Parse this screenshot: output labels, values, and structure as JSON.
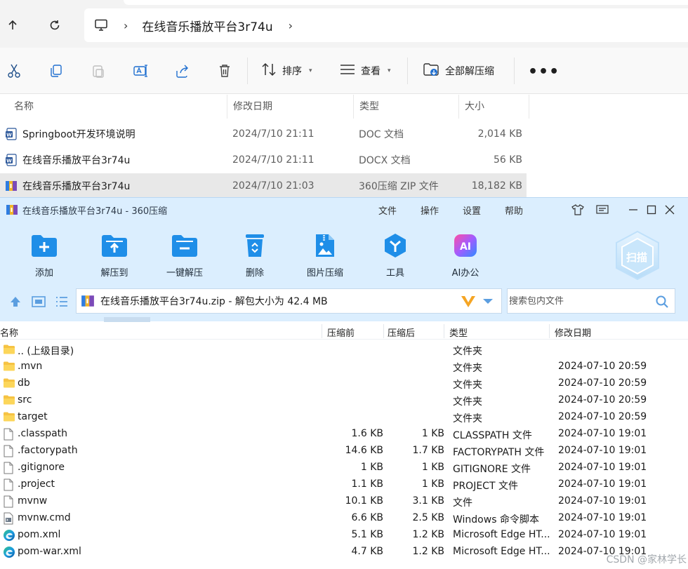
{
  "explorer": {
    "breadcrumb": "在线音乐播放平台3r74u",
    "toolbar": {
      "sort_label": "排序",
      "view_label": "查看",
      "extract_all_label": "全部解压缩"
    },
    "columns": [
      "名称",
      "修改日期",
      "类型",
      "大小"
    ],
    "files": [
      {
        "name": "Springboot开发环境说明",
        "date": "2024/7/10 21:11",
        "type": "DOC 文档",
        "size": "2,014 KB",
        "icon": "word-doc-icon"
      },
      {
        "name": "在线音乐播放平台3r74u",
        "date": "2024/7/10 21:11",
        "type": "DOCX 文档",
        "size": "56 KB",
        "icon": "word-doc-icon"
      },
      {
        "name": "在线音乐播放平台3r74u",
        "date": "2024/7/10 21:03",
        "type": "360压缩 ZIP 文件",
        "size": "18,182 KB",
        "icon": "zip-archive-icon"
      }
    ]
  },
  "zip": {
    "title": "在线音乐播放平台3r74u - 360压缩",
    "menu": [
      "文件",
      "操作",
      "设置",
      "帮助"
    ],
    "tools": [
      "添加",
      "解压到",
      "一键解压",
      "删除",
      "图片压缩",
      "工具",
      "AI办公"
    ],
    "scan_label": "扫描",
    "path_text": "在线音乐播放平台3r74u.zip - 解包大小为 42.4 MB",
    "search_placeholder": "搜索包内文件",
    "columns": {
      "name": "名称",
      "compressed_before": "压缩前",
      "compressed_after": "压缩后",
      "type": "类型",
      "modified": "修改日期"
    },
    "rows": [
      {
        "name": ".. (上级目录)",
        "before": "",
        "after": "",
        "type": "文件夹",
        "modified": "",
        "icon": "folder-icon"
      },
      {
        "name": ".mvn",
        "before": "",
        "after": "",
        "type": "文件夹",
        "modified": "2024-07-10 20:59",
        "icon": "folder-icon"
      },
      {
        "name": "db",
        "before": "",
        "after": "",
        "type": "文件夹",
        "modified": "2024-07-10 20:59",
        "icon": "folder-icon"
      },
      {
        "name": "src",
        "before": "",
        "after": "",
        "type": "文件夹",
        "modified": "2024-07-10 20:59",
        "icon": "folder-icon"
      },
      {
        "name": "target",
        "before": "",
        "after": "",
        "type": "文件夹",
        "modified": "2024-07-10 20:59",
        "icon": "folder-icon"
      },
      {
        "name": ".classpath",
        "before": "1.6 KB",
        "after": "1 KB",
        "type": "CLASSPATH 文件",
        "modified": "2024-07-10 19:01",
        "icon": "file-icon"
      },
      {
        "name": ".factorypath",
        "before": "14.6 KB",
        "after": "1.7 KB",
        "type": "FACTORYPATH 文件",
        "modified": "2024-07-10 19:01",
        "icon": "file-icon"
      },
      {
        "name": ".gitignore",
        "before": "1 KB",
        "after": "1 KB",
        "type": "GITIGNORE 文件",
        "modified": "2024-07-10 19:01",
        "icon": "file-icon"
      },
      {
        "name": ".project",
        "before": "1.1 KB",
        "after": "1 KB",
        "type": "PROJECT 文件",
        "modified": "2024-07-10 19:01",
        "icon": "file-icon"
      },
      {
        "name": "mvnw",
        "before": "10.1 KB",
        "after": "3.1 KB",
        "type": "文件",
        "modified": "2024-07-10 19:01",
        "icon": "file-icon"
      },
      {
        "name": "mvnw.cmd",
        "before": "6.6 KB",
        "after": "2.5 KB",
        "type": "Windows 命令脚本",
        "modified": "2024-07-10 19:01",
        "icon": "cmd-script-icon"
      },
      {
        "name": "pom.xml",
        "before": "5.1 KB",
        "after": "1.2 KB",
        "type": "Microsoft Edge HT...",
        "modified": "2024-07-10 19:01",
        "icon": "edge-icon"
      },
      {
        "name": "pom-war.xml",
        "before": "4.7 KB",
        "after": "1.2 KB",
        "type": "Microsoft Edge HT...",
        "modified": "2024-07-10 19:01",
        "icon": "edge-icon"
      }
    ]
  },
  "watermark": "CSDN @家林学长",
  "colors": {
    "zip_chrome": "#dbeefe",
    "accent_blue": "#1f8ee8",
    "explorer_bg": "#f3f3f3"
  }
}
